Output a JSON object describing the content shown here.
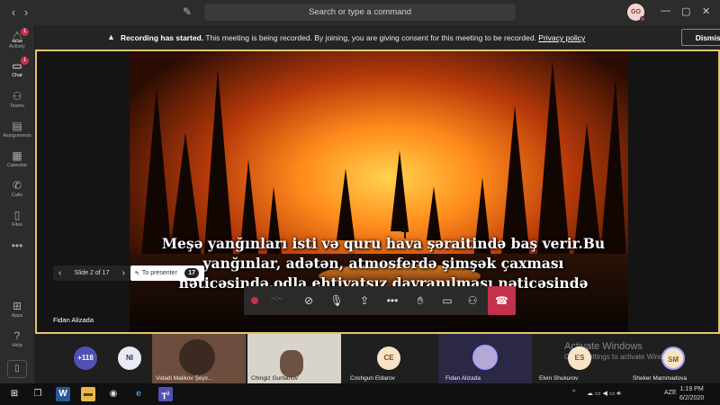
{
  "topbar": {
    "back_icon": "chevron-left-icon",
    "forward_icon": "chevron-right-icon",
    "search_placeholder": "Search or type a command",
    "user_initials": "GO",
    "window_controls": [
      "…",
      "—",
      "▢",
      "✕"
    ]
  },
  "rail": {
    "items": [
      {
        "label": "Activity",
        "badge": "1"
      },
      {
        "label": "Chat",
        "badge": "1"
      },
      {
        "label": "Teams"
      },
      {
        "label": "Assignments"
      },
      {
        "label": "Calendar"
      },
      {
        "label": "Calls"
      },
      {
        "label": "Files"
      },
      {
        "label": "•••"
      },
      {
        "label": "Apps"
      },
      {
        "label": "Help"
      }
    ]
  },
  "banner": {
    "title": "Recording has started.",
    "message": " This meeting is being recorded. By joining, you are giving consent for this meeting to be recorded. ",
    "link": "Privacy policy",
    "dismiss_label": "Dismiss"
  },
  "slide": {
    "caption_lines": [
      "Meşə yanğınları isti və quru hava şəraitində baş verir.Bu",
      "yanğınlar, adətən, atmosferdə şimşək çaxması",
      "nəticəsində,odla ehtivatsız davranılması nəticəsində"
    ],
    "nav_label": "Slide 2 of 17",
    "to_presenter_label": "To presenter",
    "to_presenter_count": "17",
    "presenter_name": "Fidan Alizada"
  },
  "controls": {
    "timer": "--:--",
    "icons": [
      "camera-off-icon",
      "mic-off-icon",
      "share-icon",
      "more-icon",
      "raise-hand-icon",
      "chat-icon",
      "participants-icon",
      "hang-up-icon"
    ]
  },
  "participants": {
    "overflow": "+118",
    "ni_initials": "NI",
    "tiles": [
      {
        "name": "Vidadi Malikov Şeyx...",
        "type": "video"
      },
      {
        "name": "Chingiz Gurbanov",
        "type": "video"
      },
      {
        "name": "Coshgun Eldarov",
        "initials": "CE"
      },
      {
        "name": "Fidan Alizada",
        "type": "avatar"
      },
      {
        "name": "Elvin Shukurov",
        "initials": "ES"
      },
      {
        "name": "Sheker Mammadova",
        "initials": "SM"
      }
    ],
    "watermark_title": "Activate Windows",
    "watermark_sub": "Go to Settings to activate Windows."
  },
  "taskbar": {
    "tray_text": "^",
    "language": "AZE",
    "time": "1:19 PM",
    "date": "6/2/2020",
    "teams_badge": "2"
  }
}
